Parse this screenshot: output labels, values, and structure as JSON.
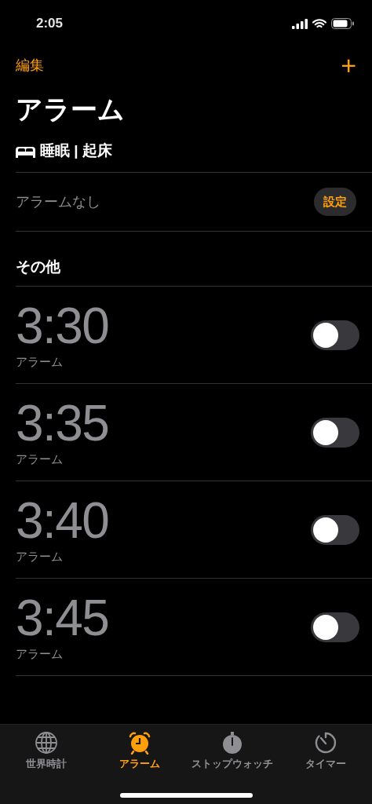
{
  "status_bar": {
    "time": "2:05"
  },
  "nav": {
    "edit": "編集",
    "add": "+"
  },
  "title": "アラーム",
  "sleep": {
    "heading": "睡眠 | 起床",
    "message": "アラームなし",
    "button": "設定"
  },
  "other": {
    "heading": "その他"
  },
  "alarms": [
    {
      "time": "3:30",
      "label": "アラーム",
      "on": false
    },
    {
      "time": "3:35",
      "label": "アラーム",
      "on": false
    },
    {
      "time": "3:40",
      "label": "アラーム",
      "on": false
    },
    {
      "time": "3:45",
      "label": "アラーム",
      "on": false
    }
  ],
  "tabs": [
    {
      "label": "世界時計",
      "kind": "globe",
      "selected": false
    },
    {
      "label": "アラーム",
      "kind": "alarm",
      "selected": true
    },
    {
      "label": "ストップウォッチ",
      "kind": "stopwatch",
      "selected": false
    },
    {
      "label": "タイマー",
      "kind": "timer",
      "selected": false
    }
  ]
}
